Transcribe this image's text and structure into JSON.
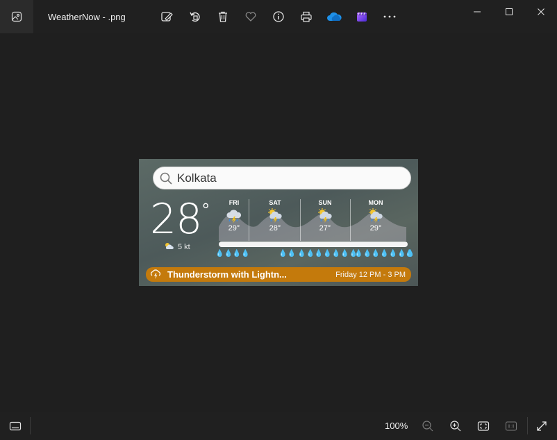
{
  "window": {
    "file_name": "WeatherNow - .png",
    "toolbar_icons": [
      "edit-image-icon",
      "rotate-icon",
      "delete-icon",
      "favorite-heart-icon",
      "info-icon",
      "print-icon",
      "onedrive-icon",
      "clipchamp-icon",
      "more-icon"
    ],
    "window_controls": [
      "minimize-icon",
      "maximize-icon",
      "close-icon"
    ]
  },
  "widget": {
    "search": "Kolkata",
    "temperature": "28",
    "degree_symbol": "°",
    "wind": "5 kt",
    "forecast": [
      {
        "day": "FRI",
        "temp": "29°",
        "icon": "cloud-lightning-icon"
      },
      {
        "day": "SAT",
        "temp": "28°",
        "icon": "sun-cloud-lightning-icon"
      },
      {
        "day": "SUN",
        "temp": "27°",
        "icon": "sun-cloud-lightning-icon"
      },
      {
        "day": "MON",
        "temp": "29°",
        "icon": "sun-cloud-lightning-icon"
      }
    ],
    "rain_drops": [
      "💧💧💧💧",
      "💧💧",
      "💧💧💧💧💧💧💧",
      "💧💧💧💧💧💧💧",
      "💧"
    ],
    "alert": {
      "text": "Thunderstorm with Lightn...",
      "time": "Friday 12 PM - 3 PM",
      "color": "#c47a0c"
    }
  },
  "statusbar": {
    "zoom": "100%"
  }
}
